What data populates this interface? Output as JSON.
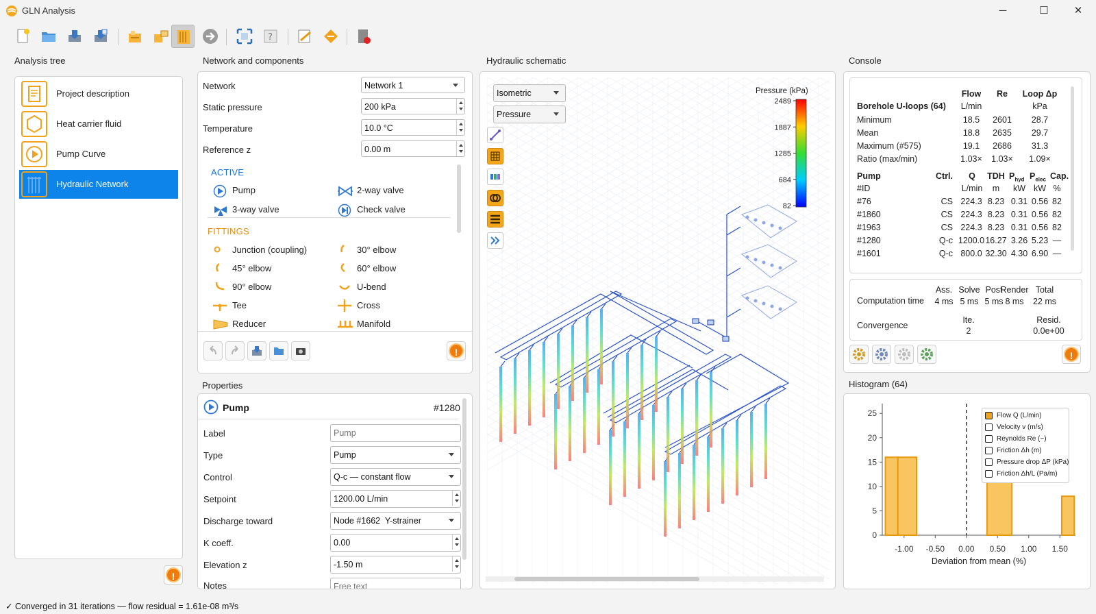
{
  "app": {
    "title": "GLN Analysis",
    "minimize": "─",
    "maximize": "☐",
    "close": "✕"
  },
  "toolbar": {
    "icons": [
      "new-file-icon",
      "open-folder-icon",
      "save-icon",
      "save-as-icon",
      "import-icon",
      "export-icon",
      "borehole-icon",
      "next-arrow-icon",
      "fit-view-icon",
      "query-icon",
      "edit-icon",
      "clean-icon",
      "report-icon"
    ]
  },
  "analysis_tree": {
    "title": "Analysis tree",
    "items": [
      {
        "label": "Project description",
        "icon": "document-icon"
      },
      {
        "label": "Heat carrier fluid",
        "icon": "hexagon-icon"
      },
      {
        "label": "Pump Curve",
        "icon": "play-circle-icon"
      },
      {
        "label": "Hydraulic Network",
        "icon": "borehole-field-icon",
        "selected": true
      }
    ],
    "warn": "!"
  },
  "network": {
    "title": "Network and components",
    "fields": [
      {
        "label": "Network",
        "value": "Network 1"
      },
      {
        "label": "Static pressure",
        "value": "200 kPa"
      },
      {
        "label": "Temperature",
        "value": "10.0 °C"
      },
      {
        "label": "Reference z",
        "value": "0.00 m"
      }
    ],
    "active_title": "ACTIVE",
    "active": [
      "Pump",
      "2-way valve",
      "3-way valve",
      "Check valve"
    ],
    "fittings_title": "FITTINGS",
    "fittings": [
      "Junction (coupling)",
      "30° elbow",
      "45° elbow",
      "60° elbow",
      "90° elbow",
      "U-bend",
      "Tee",
      "Cross",
      "Reducer",
      "Manifold"
    ],
    "warn": "!"
  },
  "properties": {
    "title": "Properties",
    "component": "Pump",
    "id": "#1280",
    "fields": [
      {
        "label": "Label",
        "value": "",
        "placeholder": "Pump"
      },
      {
        "label": "Type",
        "value": "Pump"
      },
      {
        "label": "Control",
        "value": "Q-c — constant flow"
      },
      {
        "label": "Setpoint",
        "value": "1200.00 L/min"
      },
      {
        "label": "Discharge toward",
        "value": "Node #1662  Y-strainer"
      },
      {
        "label": "K coeff.",
        "value": "0.00"
      },
      {
        "label": "Elevation z",
        "value": "-1.50 m"
      },
      {
        "label": "Notes",
        "value": "",
        "placeholder": "Free text"
      }
    ]
  },
  "schematic": {
    "title": "Hydraulic schematic",
    "view": "Isometric",
    "color_by": "Pressure",
    "legend_title": "Pressure (kPa)",
    "legend_ticks": [
      "2489",
      "1887",
      "1285",
      "684",
      "82"
    ]
  },
  "console": {
    "title": "Console",
    "borehole": {
      "title": "Borehole U-loops (64)",
      "headers": [
        "Flow",
        "Re",
        "Loop Δp"
      ],
      "units": [
        "L/min",
        "",
        "kPa"
      ],
      "rows": [
        {
          "name": "Minimum",
          "vals": [
            "18.5",
            "2601",
            "28.7"
          ]
        },
        {
          "name": "Mean",
          "vals": [
            "18.8",
            "2635",
            "29.7"
          ]
        },
        {
          "name": "Maximum (#575)",
          "vals": [
            "19.1",
            "2686",
            "31.3"
          ]
        },
        {
          "name": "Ratio (max/min)",
          "vals": [
            "1.03×",
            "1.03×",
            "1.09×"
          ]
        }
      ]
    },
    "pumps": {
      "headers": [
        "Pump",
        "Ctrl.",
        "Q",
        "TDH",
        "P",
        "P",
        "Cap."
      ],
      "header_subs": [
        "",
        "",
        "",
        "",
        "hyd",
        "elec",
        ""
      ],
      "units": [
        "#ID",
        "",
        "L/min",
        "m",
        "kW",
        "kW",
        "%"
      ],
      "rows": [
        [
          "#76",
          "CS",
          "224.3",
          "8.23",
          "0.31",
          "0.56",
          "82"
        ],
        [
          "#1860",
          "CS",
          "224.3",
          "8.23",
          "0.31",
          "0.56",
          "82"
        ],
        [
          "#1963",
          "CS",
          "224.3",
          "8.23",
          "0.31",
          "0.56",
          "82"
        ],
        [
          "#1280",
          "Q-c",
          "1200.0",
          "16.27",
          "3.26",
          "5.23",
          "—"
        ],
        [
          "#1601",
          "Q-c",
          "800.0",
          "32.30",
          "4.30",
          "6.90",
          "—"
        ]
      ]
    },
    "timing": {
      "label": "Computation time",
      "headers": [
        "Ass.",
        "Solve",
        "Post",
        "Render",
        "Total"
      ],
      "values": [
        "4 ms",
        "5 ms",
        "5 ms",
        "8 ms",
        "22 ms"
      ]
    },
    "convergence": {
      "label": "Convergence",
      "headers": [
        "Ite.",
        "Resid."
      ],
      "values": [
        "2",
        "0.0e+00"
      ]
    },
    "warn": "!"
  },
  "histogram": {
    "title": "Histogram (64)",
    "legend": [
      {
        "label": "Flow Q (L/min)",
        "checked": true
      },
      {
        "label": "Velocity v (m/s)",
        "checked": false
      },
      {
        "label": "Reynolds Re (−)",
        "checked": false
      },
      {
        "label": "Friction Δh (m)",
        "checked": false
      },
      {
        "label": "Pressure drop ΔP (kPa)",
        "checked": false
      },
      {
        "label": "Friction Δh/L (Pa/m)",
        "checked": false
      }
    ]
  },
  "chart_data": {
    "type": "bar",
    "title": "",
    "xlabel": "Deviation from mean (%)",
    "ylabel": "",
    "x_ticks": [
      "-1.00",
      "-0.50",
      "0.00",
      "0.50",
      "1.00",
      "1.50"
    ],
    "y_ticks": [
      "0",
      "5",
      "10",
      "15",
      "20",
      "25"
    ],
    "xlim": [
      -1.35,
      1.75
    ],
    "ylim": [
      0,
      27
    ],
    "bins": [
      {
        "x0": -1.3,
        "x1": -1.1,
        "count": 16
      },
      {
        "x0": -1.1,
        "x1": -0.8,
        "count": 16
      },
      {
        "x0": 0.33,
        "x1": 0.73,
        "count": 24
      },
      {
        "x0": 1.53,
        "x1": 1.73,
        "count": 8
      }
    ],
    "mean_line_x": 0.0,
    "color": "#f8c560",
    "edge_color": "#e69a10"
  },
  "status": {
    "text": "✓ Converged in 31 iterations — flow residual = 1.61e-08 m³/s"
  }
}
